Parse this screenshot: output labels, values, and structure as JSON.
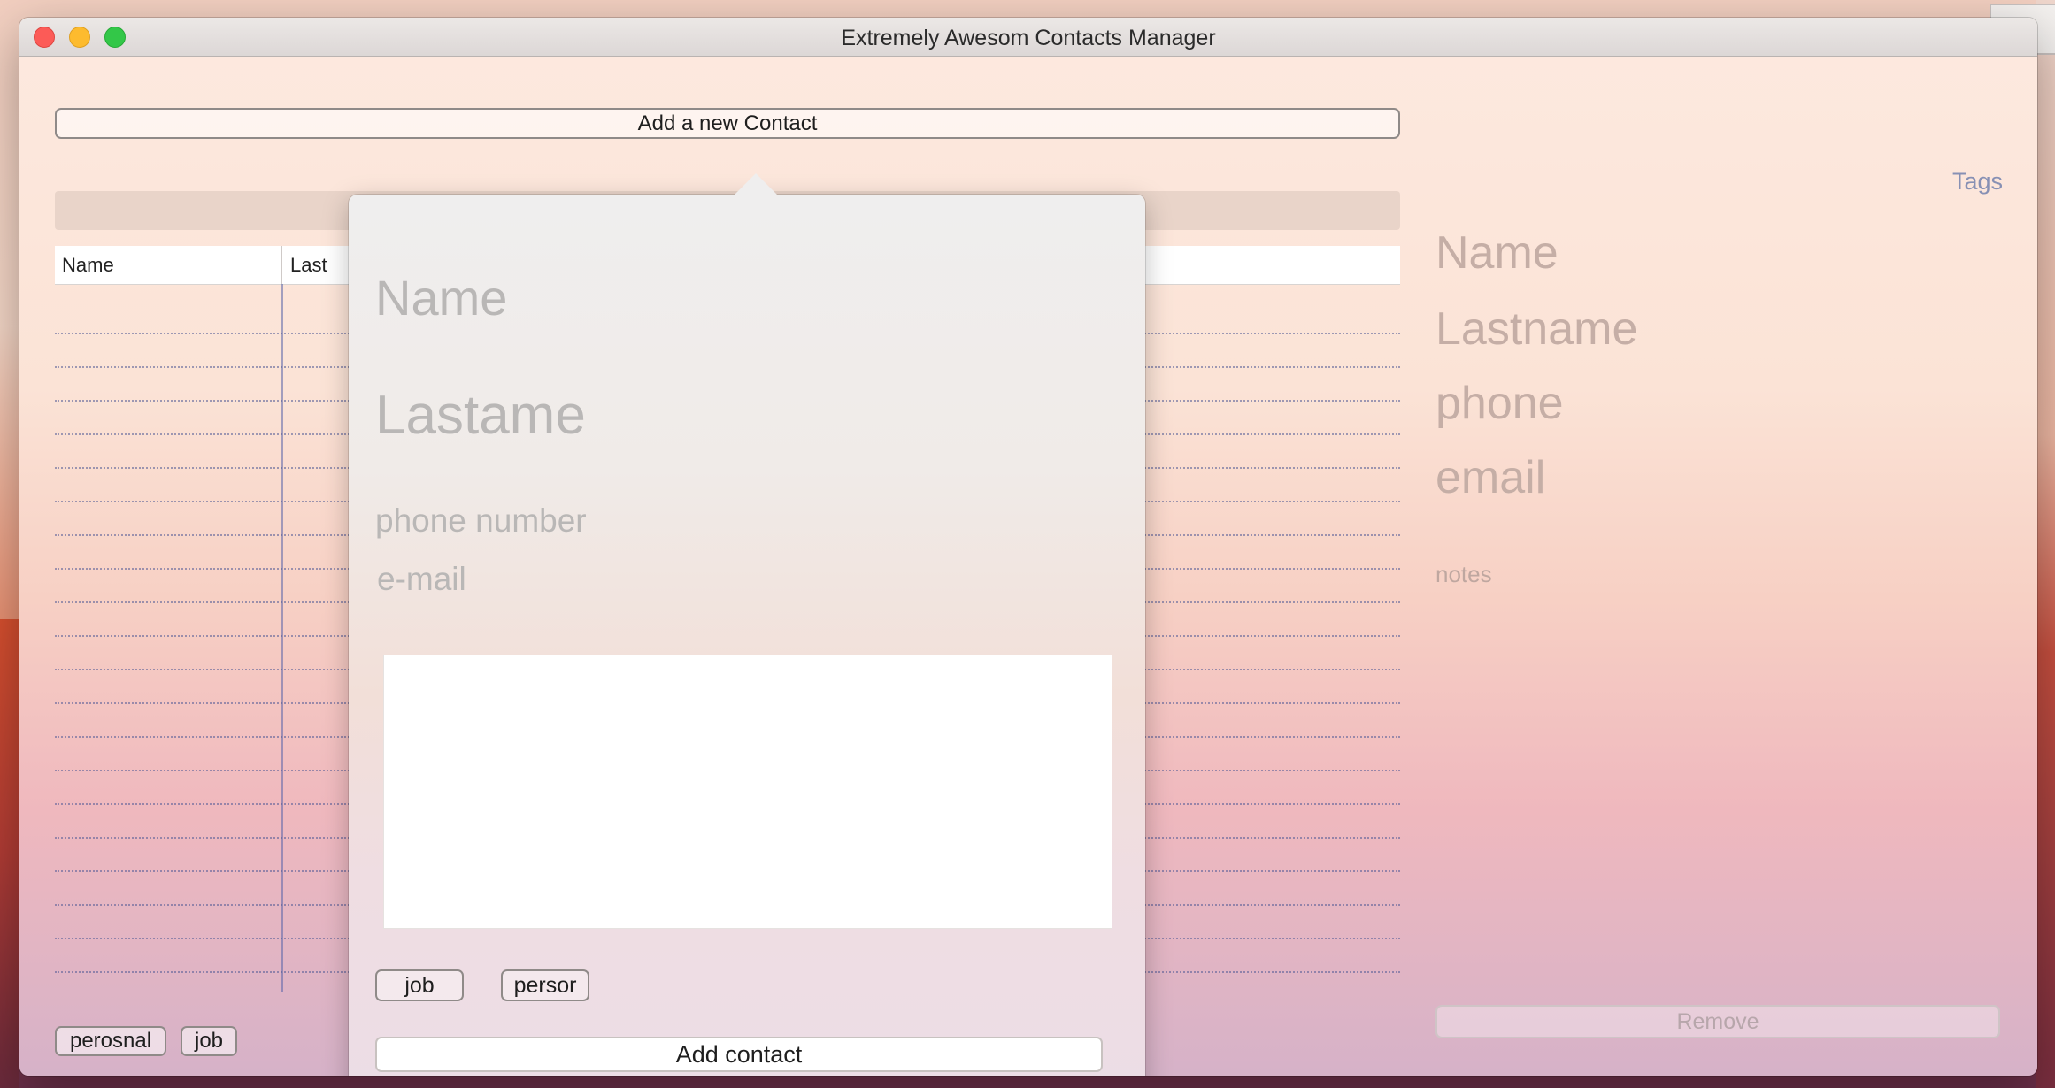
{
  "window": {
    "title": "Extremely Awesom Contacts Manager"
  },
  "toolbar": {
    "add_new_label": "Add a new Contact"
  },
  "table": {
    "columns": [
      "Name",
      "Last"
    ],
    "rows": 20
  },
  "tags_bar": {
    "items": [
      "perosnal",
      "job"
    ]
  },
  "details": {
    "tags_link": "Tags",
    "name": "Name",
    "lastname": "Lastname",
    "phone": "phone",
    "email": "email",
    "notes": "notes",
    "remove_label": "Remove"
  },
  "popover": {
    "name_placeholder": "Name",
    "lastname_placeholder": "Lastame",
    "phone_placeholder": "phone number",
    "email_placeholder": "e-mail",
    "notes_value": "",
    "tag_buttons": [
      "job",
      "persor"
    ],
    "add_label": "Add contact"
  },
  "colors": {
    "accent": "#8790b4",
    "close": "#fc5b57",
    "minimize": "#fdbb2e",
    "maximize": "#33c748"
  }
}
